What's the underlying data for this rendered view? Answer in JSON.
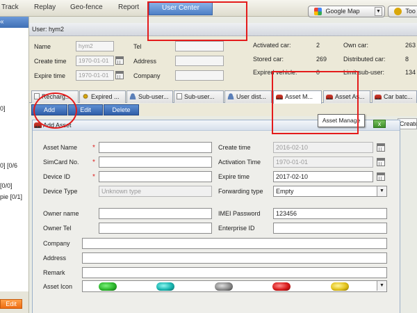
{
  "menu": {
    "track": "Track",
    "replay": "Replay",
    "geofence": "Geo-fence",
    "report": "Report",
    "user_center": "User Center",
    "map_selector": "Google Map",
    "tools": "Too"
  },
  "left_panel": {
    "frag1": "0]",
    "frag2": "0] [0/6",
    "frag3": "[0/0]",
    "frag4": "pie [0/1]",
    "edit": "Edit"
  },
  "user_bar": {
    "label": "User: hym2"
  },
  "info": {
    "name_label": "Name",
    "name_value": "hym2",
    "create_time_label": "Create time",
    "create_time_value": "1970-01-01",
    "expire_time_label": "Expire time",
    "expire_time_value": "1970-01-01",
    "tel_label": "Tel",
    "address_label": "Address",
    "company_label": "Company",
    "activated_car_label": "Activated car:",
    "activated_car_value": "2",
    "stored_car_label": "Stored car:",
    "stored_car_value": "269",
    "expired_vehicle_label": "Expired vehicle:",
    "expired_vehicle_value": "0",
    "own_car_label": "Own car:",
    "own_car_value": "263",
    "distributed_car_label": "Distributed car:",
    "distributed_car_value": "8",
    "limit_subuser_label": "Limit sub-user:",
    "limit_subuser_value": "134"
  },
  "tabs": [
    {
      "label": "Recharg...",
      "icon": "doc-icon"
    },
    {
      "label": "Expired ...",
      "icon": "gear-icon"
    },
    {
      "label": "Sub-user...",
      "icon": "user-icon"
    },
    {
      "label": "Sub-user...",
      "icon": "doc-icon"
    },
    {
      "label": "User dist...",
      "icon": "user-icon"
    },
    {
      "label": "Asset M...",
      "icon": "car-icon"
    },
    {
      "label": "Asset As...",
      "icon": "car-icon"
    },
    {
      "label": "Car batc...",
      "icon": "car-icon"
    }
  ],
  "toolbar": {
    "add": "Add",
    "edit": "Edit",
    "delete": "Delete"
  },
  "tooltip": "Asset Manage",
  "create_tab": "Create",
  "dialog": {
    "title": "Add Asset",
    "close": "x",
    "asset_name_label": "Asset Name",
    "simcard_label": "SimCard No.",
    "device_id_label": "Device ID",
    "device_type_label": "Device Type",
    "device_type_placeholder": "Unknown type",
    "owner_name_label": "Owner name",
    "owner_tel_label": "Owner Tel",
    "company_label": "Company",
    "address_label": "Address",
    "remark_label": "Remark",
    "asset_icon_label": "Asset Icon",
    "create_time_label": "Create time",
    "create_time_value": "2016-02-10",
    "activation_time_label": "Activation Time",
    "activation_time_value": "1970-01-01",
    "expire_time_label": "Expire time",
    "expire_time_value": "2017-02-10",
    "forwarding_type_label": "Forwarding type",
    "forwarding_type_value": "Empty",
    "imei_password_label": "IMEI Password",
    "imei_password_value": "123456",
    "enterprise_id_label": "Enterprise ID",
    "required_mark": "*"
  },
  "colors": {
    "annotation_red": "#e41b1b",
    "accent_blue": "#3f6fb5",
    "car_icons": [
      "#2db82d",
      "#18b5b0",
      "#8a8a8a",
      "#d81c1c",
      "#e2c21a"
    ]
  }
}
